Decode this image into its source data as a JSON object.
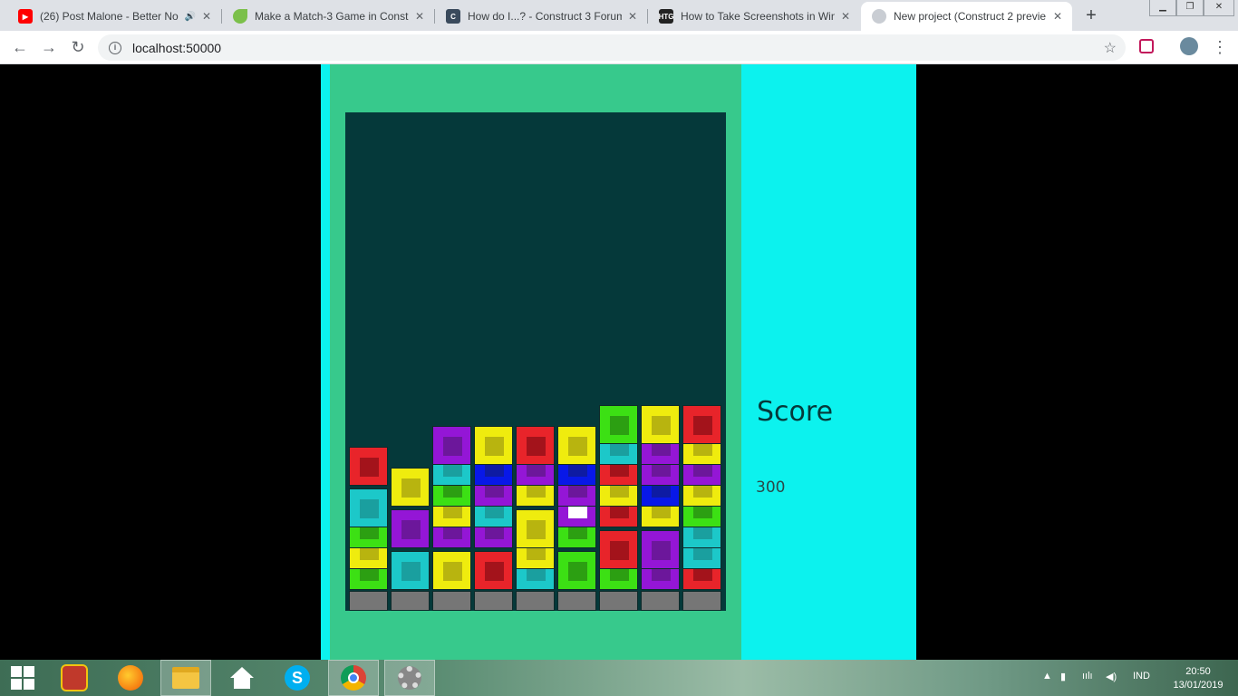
{
  "browser": {
    "tabs": [
      {
        "title": "(26) Post Malone - Better No",
        "favicon": "youtube-icon",
        "audio": true
      },
      {
        "title": "Make a Match-3 Game in Const",
        "favicon": "leaf-icon"
      },
      {
        "title": "How do I...? - Construct 3 Forum",
        "favicon": "construct-icon"
      },
      {
        "title": "How to Take Screenshots in Win",
        "favicon": "htg-icon",
        "favicon_text": "HTG"
      },
      {
        "title": "New project (Construct 2 previe",
        "favicon": "globe-icon",
        "active": true
      }
    ],
    "new_tab_label": "+",
    "url": "localhost:50000"
  },
  "game": {
    "score_label": "Score",
    "score_value": "300",
    "colors": {
      "red": [
        "#e8242a",
        "#a3131b"
      ],
      "yellow": [
        "#efec0e",
        "#b8b40f"
      ],
      "purple": [
        "#9416d6",
        "#6c179b"
      ],
      "teal": [
        "#1cc8c9",
        "#1a9f9f"
      ],
      "blue": [
        "#0818e8",
        "#0e1ba3"
      ],
      "green": [
        "#3ce014",
        "#2c9f12"
      ],
      "gray": [
        "#767676",
        "#767676"
      ],
      "white": [
        "#9416d6",
        "#ffffff"
      ]
    },
    "grid": {
      "columns": 9,
      "rows_from_bottom": [
        [
          "gray",
          "gray",
          "gray",
          "gray",
          "gray",
          "gray",
          "gray",
          "gray",
          "gray"
        ],
        [
          "green",
          "teal",
          "yellow",
          "red",
          "teal",
          "green",
          "green",
          "purple",
          "red"
        ],
        [
          "yellow",
          "",
          "",
          "",
          "yellow",
          "",
          "red",
          "purple",
          "teal"
        ],
        [
          "green",
          "purple",
          "purple",
          "purple",
          "yellow",
          "green",
          "",
          "",
          "teal"
        ],
        [
          "teal",
          "",
          "yellow",
          "teal",
          "",
          "white",
          "red",
          "yellow",
          "green"
        ],
        [
          "",
          "yellow",
          "green",
          "purple",
          "yellow",
          "purple",
          "yellow",
          "blue",
          "yellow"
        ],
        [
          "red",
          "",
          "teal",
          "blue",
          "purple",
          "blue",
          "red",
          "purple",
          "purple"
        ],
        [
          "",
          "",
          "purple",
          "yellow",
          "red",
          "yellow",
          "teal",
          "purple",
          "yellow"
        ],
        [
          "",
          "",
          "",
          "",
          "",
          "",
          "green",
          "yellow",
          "red"
        ]
      ]
    }
  },
  "taskbar": {
    "apps": [
      "windows-start-icon",
      "pokemon-app-icon",
      "firefox-icon",
      "file-explorer-icon",
      "home-icon",
      "skype-icon",
      "chrome-icon",
      "settings-icon"
    ],
    "language": "IND",
    "time": "20:50",
    "date": "13/01/2019"
  }
}
